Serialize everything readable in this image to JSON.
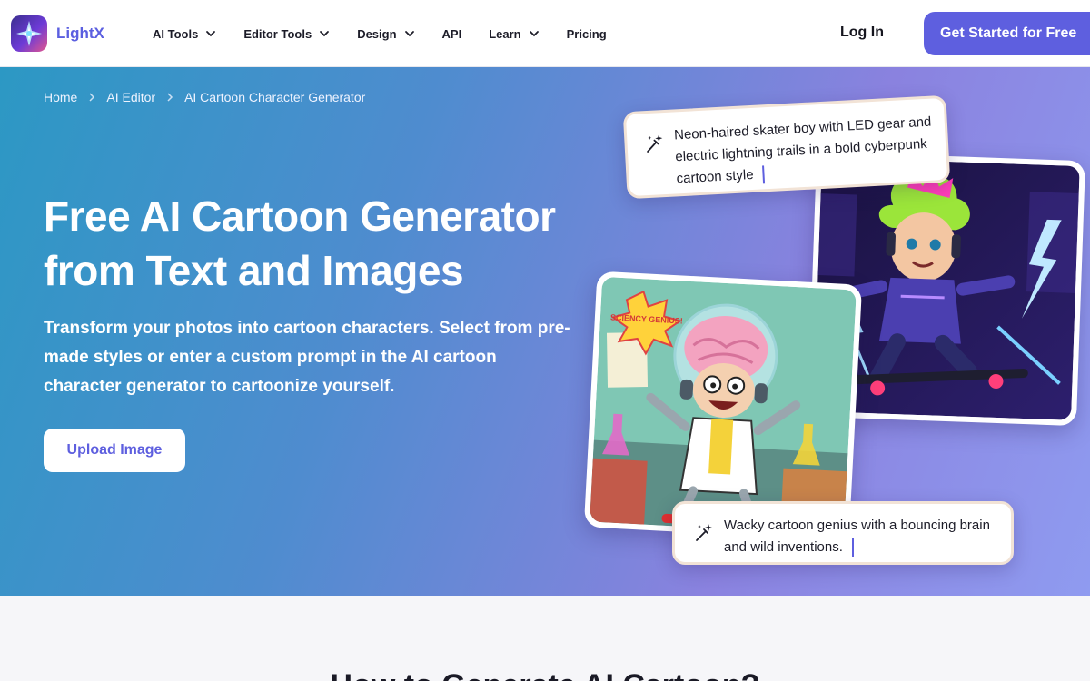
{
  "brand": {
    "name": "LightX",
    "accent": "#5e5fdf"
  },
  "nav": {
    "items": [
      {
        "label": "AI Tools",
        "dropdown": true
      },
      {
        "label": "Editor Tools",
        "dropdown": true
      },
      {
        "label": "Design",
        "dropdown": true
      },
      {
        "label": "API",
        "dropdown": false
      },
      {
        "label": "Learn",
        "dropdown": true
      },
      {
        "label": "Pricing",
        "dropdown": false
      }
    ],
    "login_label": "Log In",
    "cta_label": "Get Started for Free"
  },
  "breadcrumb": [
    "Home",
    "AI Editor",
    "AI Cartoon Character Generator"
  ],
  "hero": {
    "title_line1": "Free AI Cartoon Generator",
    "title_line2": "from Text and Images",
    "subtitle": "Transform your photos into cartoon characters. Select from pre-made styles or enter a custom prompt in the AI cartoon character generator to cartoonize yourself.",
    "upload_label": "Upload Image"
  },
  "prompts": {
    "skater": "Neon-haired skater boy with LED gear and electric lightning trails in a bold cyberpunk cartoon style",
    "genius": "Wacky cartoon genius with a bouncing brain and wild inventions."
  },
  "images": {
    "skater_badge_text": "",
    "genius_badge_text": "SCIENCY GENIUS!"
  },
  "next_section": {
    "title": "How to Generate AI Cartoon?"
  },
  "icons": {
    "chevron": "chevron-down-icon",
    "breadcrumb_sep": "chevron-right-icon",
    "wand": "magic-wand-icon"
  }
}
